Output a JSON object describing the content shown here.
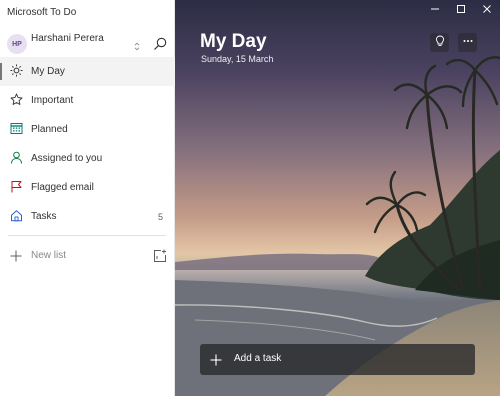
{
  "app": {
    "title": "Microsoft To Do"
  },
  "user": {
    "initials": "HP",
    "name": "Harshani Perera",
    "email": ""
  },
  "sidebar": {
    "items": [
      {
        "label": "My Day",
        "icon": "sun-icon",
        "count": ""
      },
      {
        "label": "Important",
        "icon": "star-icon",
        "count": ""
      },
      {
        "label": "Planned",
        "icon": "calendar-icon",
        "count": ""
      },
      {
        "label": "Assigned to you",
        "icon": "person-icon",
        "count": ""
      },
      {
        "label": "Flagged email",
        "icon": "flag-icon",
        "count": ""
      },
      {
        "label": "Tasks",
        "icon": "home-icon",
        "count": "5"
      }
    ],
    "new_list_label": "New list"
  },
  "main": {
    "title": "My Day",
    "date": "Sunday, 15 March",
    "add_task_label": "Add a task"
  },
  "colors": {
    "accent": "#2564cf",
    "planned": "#008272",
    "assigned": "#107c41",
    "flag": "#c50f1f",
    "tasks": "#2564cf"
  }
}
